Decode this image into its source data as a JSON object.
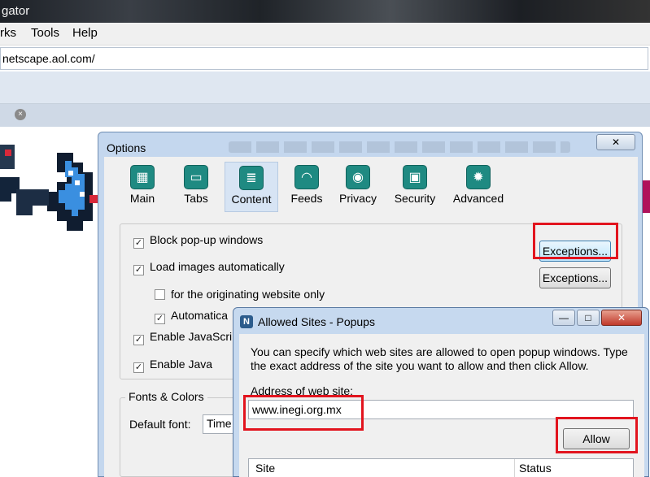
{
  "browser": {
    "title_fragment": "gator",
    "menus": [
      "rks",
      "Tools",
      "Help"
    ],
    "url": "netscape.aol.com/",
    "tab_close": "×"
  },
  "options": {
    "title": "Options",
    "window_close": "✕",
    "tabs": [
      {
        "label": "Main",
        "icon": "main-icon",
        "glyph": "▦"
      },
      {
        "label": "Tabs",
        "icon": "tabs-icon",
        "glyph": "▭"
      },
      {
        "label": "Content",
        "icon": "content-icon",
        "glyph": "≣"
      },
      {
        "label": "Feeds",
        "icon": "feeds-icon",
        "glyph": "◠"
      },
      {
        "label": "Privacy",
        "icon": "privacy-icon",
        "glyph": "◉"
      },
      {
        "label": "Security",
        "icon": "security-icon",
        "glyph": "▣"
      },
      {
        "label": "Advanced",
        "icon": "advanced-icon",
        "glyph": "✹"
      }
    ],
    "checkboxes": {
      "block_popups": {
        "label": "Block pop-up windows",
        "checked": true
      },
      "load_images": {
        "label": "Load images automatically",
        "checked": true
      },
      "originating_site": {
        "label": "for the originating website only",
        "checked": false
      },
      "automatically": {
        "label": "Automatica",
        "checked": true
      },
      "enable_javascript": {
        "label": "Enable JavaScript",
        "checked": true
      },
      "enable_java": {
        "label": "Enable Java",
        "checked": true
      }
    },
    "exceptions_popups_label": "Exceptions...",
    "exceptions_images_label": "Exceptions...",
    "fonts_group_label": "Fonts & Colors",
    "default_font_label": "Default font:",
    "default_font_value": "Time"
  },
  "allowed_sites": {
    "title": "Allowed Sites - Popups",
    "logo_letter": "N",
    "window_buttons": {
      "minimize": "—",
      "maximize": "□",
      "close": "✕"
    },
    "description": "You can specify which web sites are allowed to open popup windows. Type the exact address of the site you want to allow and then click Allow.",
    "address_label": "Address of web site:",
    "address_value": "www.inegi.org.mx",
    "allow_label": "Allow",
    "columns": [
      "Site",
      "Status"
    ]
  },
  "colors": {
    "highlight_box": "#e2141e",
    "options_tab_icon": "#1f8a82",
    "dialog_frame": "#c4d7ee"
  }
}
